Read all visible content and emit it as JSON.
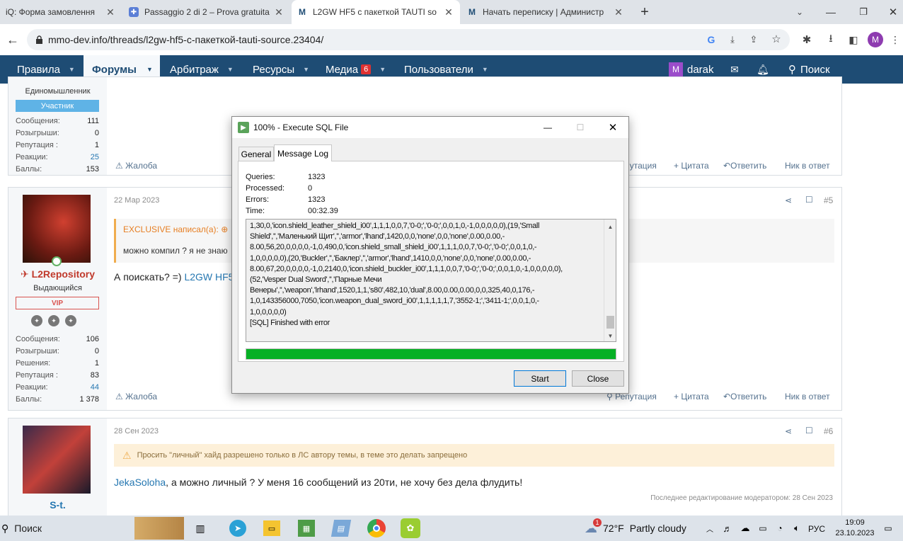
{
  "browser": {
    "tabs": [
      {
        "title": "iQ: Форма замовлення",
        "icon": "page-icon"
      },
      {
        "title": "Passaggio 2 di 2 – Prova gratuita",
        "icon": "puzzle-icon"
      },
      {
        "title": "L2GW HF5 с пакеткой TAUTI so",
        "icon": "m-logo-icon"
      },
      {
        "title": "Начать переписку | Администр",
        "icon": "m-logo-icon"
      }
    ],
    "url": "mmo-dev.info/threads/l2gw-hf5-с-пакеткой-tauti-source.23404/",
    "profile_letter": "M"
  },
  "site_nav": {
    "items": [
      "Правила",
      "Форумы",
      "Арбитраж",
      "Ресурсы",
      "Медиа",
      "Пользователи"
    ],
    "media_badge": "6",
    "user_letter": "M",
    "username": "darak",
    "search": "Поиск"
  },
  "post1": {
    "user_title": "Единомышленник",
    "badge": "Участник",
    "stats": [
      {
        "k": "Сообщения:",
        "v": "111"
      },
      {
        "k": "Розыгрыши:",
        "v": "0"
      },
      {
        "k": "Репутация :",
        "v": "1"
      },
      {
        "k": "Реакции:",
        "v": "25"
      },
      {
        "k": "Баллы:",
        "v": "153"
      }
    ],
    "report": "Жалоба",
    "reputation": "Репутация",
    "quote": "+ Цитата",
    "reply": "Ответить",
    "nick": "Ник в ответ"
  },
  "post2": {
    "date": "22 Мар 2023",
    "num": "#5",
    "username": "L2Repository",
    "user_title": "Выдающийся",
    "badge": "VIP",
    "stats": [
      {
        "k": "Сообщения:",
        "v": "106"
      },
      {
        "k": "Розыгрыши:",
        "v": "0"
      },
      {
        "k": "Решения:",
        "v": "1"
      },
      {
        "k": "Репутация :",
        "v": "83"
      },
      {
        "k": "Реакции:",
        "v": "44"
      },
      {
        "k": "Баллы:",
        "v": "1 378"
      }
    ],
    "quote_author": "EXCLUSIVE написал(а):",
    "quote_text": "можно компил ? я не знаю",
    "text": "А поискать? =)",
    "link": "L2GW HF5",
    "report": "Жалоба",
    "reputation": "Репутация",
    "quote": "+ Цитата",
    "reply": "Ответить",
    "nick": "Ник в ответ"
  },
  "post3": {
    "date": "28 Сен 2023",
    "num": "#6",
    "username": "S-t.",
    "warning": "Просить \"личный\" хайд разрешено только в ЛС автору темы, в теме это делать запрещено",
    "mention": "JekaSoloha",
    "text": ", а можно личный ? У меня 16 сообщений из 20ти, не хочу без дела флудить!",
    "edited": "Последнее редактирование модератором: 28 Сен 2023"
  },
  "dialog": {
    "title": "100% - Execute SQL File",
    "tabs": [
      "General",
      "Message Log"
    ],
    "fields": [
      {
        "k": "Queries:",
        "v": "1323"
      },
      {
        "k": "Processed:",
        "v": "0"
      },
      {
        "k": "Errors:",
        "v": "1323"
      },
      {
        "k": "Time:",
        "v": "00:32.39"
      }
    ],
    "log_lines": [
      "1,30,0,'icon.shield_leather_shield_i00',1,1,1,0,0,7,'0-0;','0-0;',0,0,1,0,-1,0,0,0,0,0),(19,'Small",
      "Shield','','Маленький Щит','','armor','lhand',1420,0,0,'none',0,0,'none',0.00,0.00,-",
      "8.00,56,20,0,0,0,0,-1,0,490,0,'icon.shield_small_shield_i00',1,1,1,0,0,7,'0-0;','0-0;',0,0,1,0,-",
      "1,0,0,0,0,0),(20,'Buckler','','Баклер','','armor','lhand',1410,0,0,'none',0,0,'none',0.00,0.00,-",
      "8.00,67,20,0,0,0,0,-1,0,2140,0,'icon.shield_buckler_i00',1,1,1,0,0,7,'0-0;','0-0;',0,0,1,0,-1,0,0,0,0,0),",
      "(52,'Vesper Dual Sword','','Парные Мечи",
      "Венеры','','weapon','lrhand',1520,1,1,'s80',482,10,'dual',8.00,0.00,0.00,0,0,325,40,0,176,-",
      "1,0,143356000,7050,'icon.weapon_dual_sword_i00',1,1,1,1,1,7,'3552-1;','3411-1;',0,0,1,0,-",
      "1,0,0,0,0,0)",
      "[SQL] Finished with error"
    ],
    "progress": 1.0,
    "start": "Start",
    "close": "Close"
  },
  "taskbar": {
    "search": "Поиск",
    "weather_badge": "1",
    "temp": "72°F",
    "weather": "Partly cloudy",
    "lang": "РУС",
    "time": "19:09",
    "date": "23.10.2023"
  },
  "colors": {
    "nav": "#1e4c74",
    "accent": "#2577b1",
    "progress": "#06b025",
    "vip": "#d9534f"
  }
}
